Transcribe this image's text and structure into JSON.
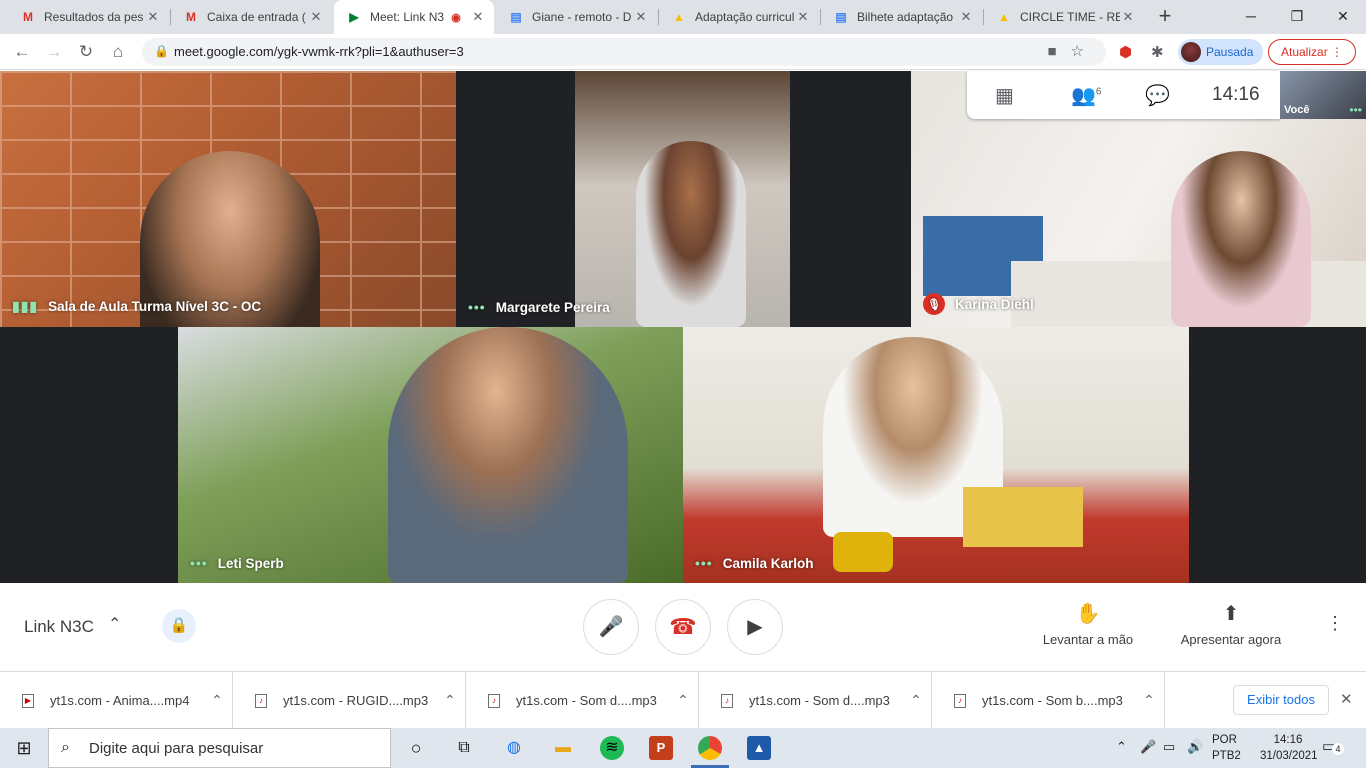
{
  "browser": {
    "tabs": [
      {
        "title": "Resultados da pes",
        "favicon": "gmail-icon",
        "active": false
      },
      {
        "title": "Caixa de entrada (",
        "favicon": "gmail-icon",
        "active": false
      },
      {
        "title": "Meet: Link N3",
        "favicon": "meet-icon",
        "active": true
      },
      {
        "title": "Giane - remoto - D",
        "favicon": "docs-icon",
        "active": false
      },
      {
        "title": "Adaptação curricul",
        "favicon": "drive-icon",
        "active": false
      },
      {
        "title": "Bilhete adaptação",
        "favicon": "docs-icon",
        "active": false
      },
      {
        "title": "CIRCLE TIME - REM",
        "favicon": "drive-icon",
        "active": false
      }
    ],
    "url": "meet.google.com/ygk-vwmk-rrk?pli=1&authuser=3",
    "profile_label": "Pausada",
    "update_label": "Atualizar"
  },
  "meet": {
    "participants": [
      {
        "name": "Sala de Aula Turma Nível 3C - OC",
        "status": "speaking"
      },
      {
        "name": "Margarete Pereira",
        "status": "more"
      },
      {
        "name": "Karina Diehl",
        "status": "muted"
      },
      {
        "name": "Leti Sperb",
        "status": "more"
      },
      {
        "name": "Camila Karloh",
        "status": "more"
      }
    ],
    "participant_count": "6",
    "time": "14:16",
    "self_label": "Você",
    "meeting_name": "Link N3C",
    "raise_hand_label": "Levantar a mão",
    "present_label": "Apresentar agora"
  },
  "downloads": {
    "items": [
      {
        "name": "yt1s.com - Anima....mp4"
      },
      {
        "name": "yt1s.com - RUGID....mp3"
      },
      {
        "name": "yt1s.com - Som d....mp3"
      },
      {
        "name": "yt1s.com - Som d....mp3"
      },
      {
        "name": "yt1s.com - Som b....mp3"
      }
    ],
    "show_all_label": "Exibir todos"
  },
  "taskbar": {
    "search_placeholder": "Digite aqui para pesquisar",
    "lang_line1": "POR",
    "lang_line2": "PTB2",
    "time": "14:16",
    "date": "31/03/2021",
    "notification_count": "4"
  },
  "colors": {
    "meet_bg": "#202124",
    "accent_blue": "#1a73e8",
    "danger_red": "#d93025",
    "speaking_green": "#8ee4af"
  }
}
